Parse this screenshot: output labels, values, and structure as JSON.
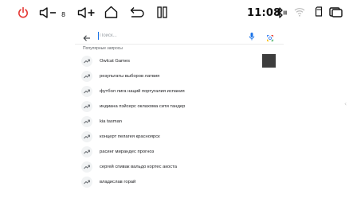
{
  "status_bar": {
    "power_icon": "power-icon",
    "volume_down_icon": "volume-down-icon",
    "volume_level": "8",
    "volume_up_icon": "volume-up-icon",
    "home_icon": "home-icon",
    "back_icon": "back-icon",
    "recents_icon": "recents-icon",
    "time": "11:08",
    "bluetooth_icon": "bluetooth-icon",
    "wifi_icon": "wifi-icon",
    "sd_card_icon": "sd-card-icon",
    "window_icon": "window-icon",
    "power_color": "#e53935"
  },
  "search": {
    "placeholder": "Поиск...",
    "value": "",
    "back_icon": "arrow-left-icon",
    "mic_icon": "mic-icon",
    "lens_icon": "lens-icon",
    "mic_color": "#1a73e8"
  },
  "trending": {
    "label": "Популярные запросы",
    "icon": "trending-up-icon",
    "items": [
      {
        "text": "Owlcat Games"
      },
      {
        "text": "результаты выборов латвия"
      },
      {
        "text": "футбол лига наций португалия испания"
      },
      {
        "text": "индиана пэйсерс оклахома сити тандер"
      },
      {
        "text": "kia tasman"
      },
      {
        "text": "концерт пелагея красноярск"
      },
      {
        "text": "расинг мирандес прогноз"
      },
      {
        "text": "сергей спивак вальдо кортес акоста"
      },
      {
        "text": "владислав горай"
      }
    ]
  }
}
